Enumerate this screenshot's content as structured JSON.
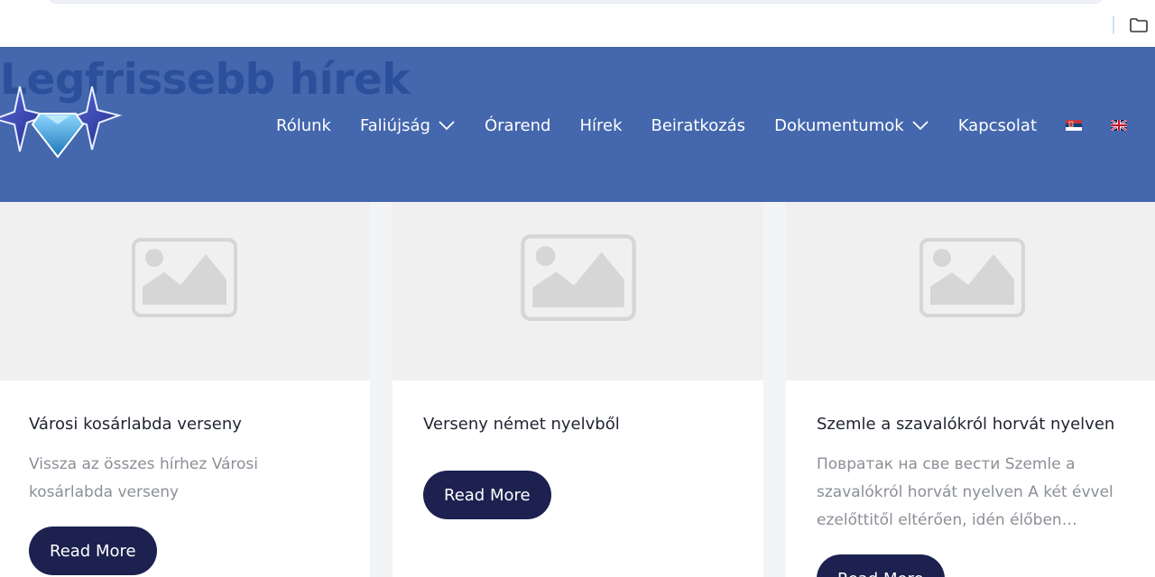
{
  "header": {
    "title": "Legfrissebb hírek",
    "colors": {
      "bar": "#4467ad",
      "title": "#2c4f9c"
    }
  },
  "nav": {
    "items": [
      {
        "label": "Rólunk",
        "has_dropdown": false
      },
      {
        "label": "Faliújság",
        "has_dropdown": true
      },
      {
        "label": "Órarend",
        "has_dropdown": false
      },
      {
        "label": "Hírek",
        "has_dropdown": false
      },
      {
        "label": "Beiratkozás",
        "has_dropdown": false
      },
      {
        "label": "Dokumentumok",
        "has_dropdown": true
      },
      {
        "label": "Kapcsolat",
        "has_dropdown": false
      }
    ],
    "flags": [
      "serbian-flag-icon",
      "uk-flag-icon",
      "hungarian-flag-icon"
    ]
  },
  "cards": [
    {
      "title": "Városi kosárlabda verseny",
      "excerpt": "Vissza az összes hírhez Városi kosárlabda verseny",
      "button": "Read More"
    },
    {
      "title": "Verseny német nyelvből",
      "excerpt": "",
      "button": "Read More"
    },
    {
      "title": "Szemle a szavalókról horvát nyelven",
      "excerpt": "Повратак на све вести Szemle a szavalókról horvát nyelven A két évvel ezelőttitől eltérően, idén élőben…",
      "button": "Read More"
    }
  ],
  "colors": {
    "button": "#1c2150",
    "placeholder": "#f0f0f0"
  }
}
